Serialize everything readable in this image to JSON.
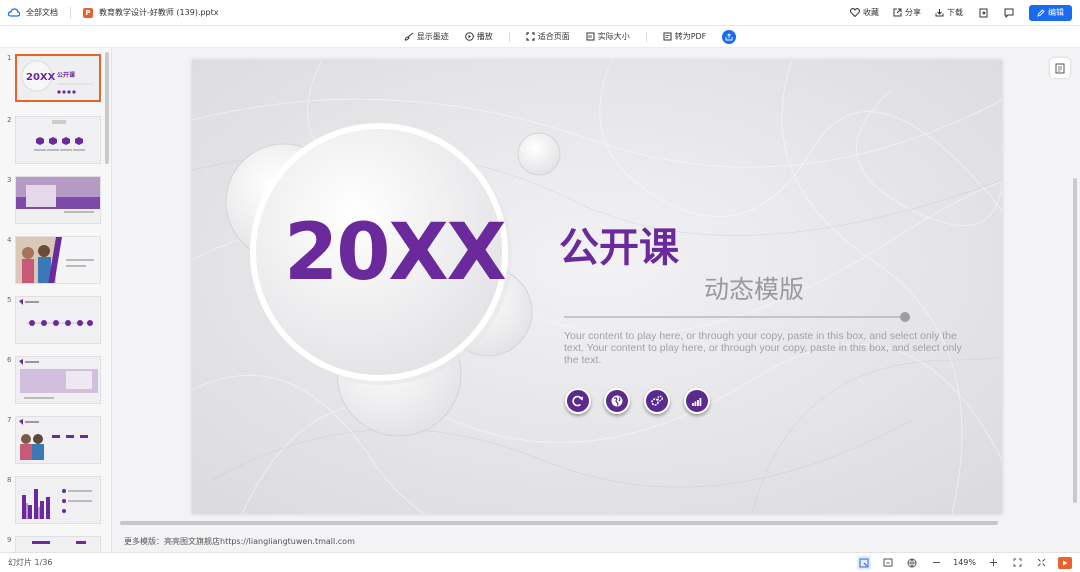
{
  "header": {
    "all_docs": "全部文档",
    "file_badge": "P",
    "filename": "教育教学设计-好教师 (139).pptx",
    "favorite": "收藏",
    "share": "分享",
    "download": "下载",
    "edit": "编辑"
  },
  "toolbar": {
    "show_ink": "显示墨迹",
    "play": "播放",
    "fit_page": "适合页面",
    "actual_size": "实际大小",
    "to_pdf": "转为PDF"
  },
  "sidebar": {
    "thumbnails": [
      {
        "num": "1",
        "label": "20XX",
        "sub": "公开课"
      },
      {
        "num": "2"
      },
      {
        "num": "3"
      },
      {
        "num": "4"
      },
      {
        "num": "5"
      },
      {
        "num": "6"
      },
      {
        "num": "7"
      },
      {
        "num": "8"
      },
      {
        "num": "9"
      }
    ]
  },
  "slide": {
    "year": "20XX",
    "title": "公开课",
    "subtitle": "动态模版",
    "body": "Your content to play here, or through your copy, paste in this box, and select only the text. Your content to play here, or through your copy, paste in this box, and select only the text.",
    "features": [
      "refresh-icon",
      "globe-icon",
      "gears-icon",
      "signal-icon"
    ]
  },
  "footer_note": "更多模版：亮亮图文旗舰店https://liangliangtuwen.tmall.com",
  "status": {
    "slide_counter": "幻灯片 1/36",
    "zoom": "149%"
  },
  "colors": {
    "accent_purple": "#6a2a9c",
    "edit_blue": "#1a6bf0",
    "ppt_orange": "#e8622c"
  }
}
